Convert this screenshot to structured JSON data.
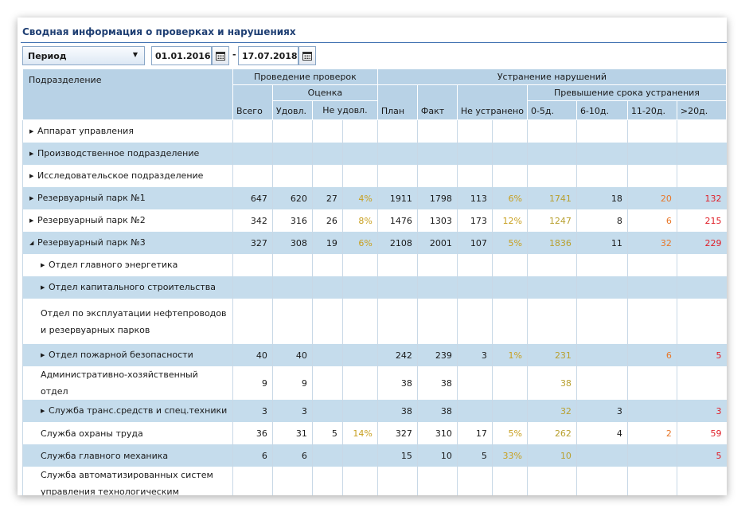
{
  "title": "Сводная информация о проверках и нарушениях",
  "toolbar": {
    "period_label": "Период",
    "date_from": "01.01.2016",
    "date_sep": "-",
    "date_to": "17.07.2018"
  },
  "headers": {
    "division": "Подразделение",
    "inspections": "Проведение проверок",
    "rating": "Оценка",
    "total": "Всего",
    "satisfactory": "Удовл.",
    "unsatisfactory": "Не удовл.",
    "elimination": "Устранение нарушений",
    "plan": "План",
    "fact": "Факт",
    "not_eliminated": "Не устранено",
    "overdue": "Превышение срока устранения",
    "d0_5": "0-5д.",
    "d6_10": "6-10д.",
    "d11_20": "11-20д.",
    "d20": ">20д."
  },
  "colors": {
    "header_bg": "#b8d2e6",
    "row_alt_bg": "#c5dcec",
    "title_color": "#1f3f73",
    "pct_color": "#c8a020",
    "orange": "#e8782a",
    "red": "#e0202a"
  },
  "rows": [
    {
      "name": "Аппарат управления",
      "expand": "collapsed",
      "level": 0,
      "alt": false,
      "tall": false,
      "total": "",
      "sat": "",
      "unsat": "",
      "unsat_pct": "",
      "plan": "",
      "fact": "",
      "not_elim": "",
      "not_elim_pct": "",
      "d0_5": "",
      "d6_10": "",
      "d11_20": "",
      "d20": ""
    },
    {
      "name": "Производственное подразделение",
      "expand": "collapsed",
      "level": 0,
      "alt": true,
      "tall": false,
      "total": "",
      "sat": "",
      "unsat": "",
      "unsat_pct": "",
      "plan": "",
      "fact": "",
      "not_elim": "",
      "not_elim_pct": "",
      "d0_5": "",
      "d6_10": "",
      "d11_20": "",
      "d20": ""
    },
    {
      "name": "Исследовательское подразделение",
      "expand": "collapsed",
      "level": 0,
      "alt": false,
      "tall": false,
      "total": "",
      "sat": "",
      "unsat": "",
      "unsat_pct": "",
      "plan": "",
      "fact": "",
      "not_elim": "",
      "not_elim_pct": "",
      "d0_5": "",
      "d6_10": "",
      "d11_20": "",
      "d20": ""
    },
    {
      "name": "Резервуарный парк №1",
      "expand": "collapsed",
      "level": 0,
      "alt": true,
      "tall": false,
      "total": "647",
      "sat": "620",
      "unsat": "27",
      "unsat_pct": "4%",
      "plan": "1911",
      "fact": "1798",
      "not_elim": "113",
      "not_elim_pct": "6%",
      "d0_5": "1741",
      "d6_10": "18",
      "d11_20": "20",
      "d20": "132"
    },
    {
      "name": "Резервуарный парк №2",
      "expand": "collapsed",
      "level": 0,
      "alt": false,
      "tall": false,
      "total": "342",
      "sat": "316",
      "unsat": "26",
      "unsat_pct": "8%",
      "plan": "1476",
      "fact": "1303",
      "not_elim": "173",
      "not_elim_pct": "12%",
      "d0_5": "1247",
      "d6_10": "8",
      "d11_20": "6",
      "d20": "215"
    },
    {
      "name": "Резервуарный парк №3",
      "expand": "expanded",
      "level": 0,
      "alt": true,
      "tall": false,
      "total": "327",
      "sat": "308",
      "unsat": "19",
      "unsat_pct": "6%",
      "plan": "2108",
      "fact": "2001",
      "not_elim": "107",
      "not_elim_pct": "5%",
      "d0_5": "1836",
      "d6_10": "11",
      "d11_20": "32",
      "d20": "229"
    },
    {
      "name": "Отдел главного энергетика",
      "expand": "collapsed",
      "level": 1,
      "alt": false,
      "tall": false,
      "total": "",
      "sat": "",
      "unsat": "",
      "unsat_pct": "",
      "plan": "",
      "fact": "",
      "not_elim": "",
      "not_elim_pct": "",
      "d0_5": "",
      "d6_10": "",
      "d11_20": "",
      "d20": ""
    },
    {
      "name": "Отдел капитального строительства",
      "expand": "collapsed",
      "level": 1,
      "alt": true,
      "tall": false,
      "total": "",
      "sat": "",
      "unsat": "",
      "unsat_pct": "",
      "plan": "",
      "fact": "",
      "not_elim": "",
      "not_elim_pct": "",
      "d0_5": "",
      "d6_10": "",
      "d11_20": "",
      "d20": ""
    },
    {
      "name": "Отдел по эксплуатации нефтепроводов и резервуарных парков",
      "expand": "none",
      "level": 1,
      "alt": false,
      "tall": true,
      "total": "",
      "sat": "",
      "unsat": "",
      "unsat_pct": "",
      "plan": "",
      "fact": "",
      "not_elim": "",
      "not_elim_pct": "",
      "d0_5": "",
      "d6_10": "",
      "d11_20": "",
      "d20": ""
    },
    {
      "name": "Отдел пожарной безопасности",
      "expand": "collapsed",
      "level": 1,
      "alt": true,
      "tall": false,
      "total": "40",
      "sat": "40",
      "unsat": "",
      "unsat_pct": "",
      "plan": "242",
      "fact": "239",
      "not_elim": "3",
      "not_elim_pct": "1%",
      "d0_5": "231",
      "d6_10": "",
      "d11_20": "6",
      "d20": "5"
    },
    {
      "name": "Административно-хозяйственный отдел",
      "expand": "none",
      "level": 1,
      "alt": false,
      "tall": false,
      "total": "9",
      "sat": "9",
      "unsat": "",
      "unsat_pct": "",
      "plan": "38",
      "fact": "38",
      "not_elim": "",
      "not_elim_pct": "",
      "d0_5": "38",
      "d6_10": "",
      "d11_20": "",
      "d20": ""
    },
    {
      "name": "Служба транс.средств и спец.техники",
      "expand": "collapsed",
      "level": 1,
      "alt": true,
      "tall": false,
      "total": "3",
      "sat": "3",
      "unsat": "",
      "unsat_pct": "",
      "plan": "38",
      "fact": "38",
      "not_elim": "",
      "not_elim_pct": "",
      "d0_5": "32",
      "d6_10": "3",
      "d11_20": "",
      "d20": "3"
    },
    {
      "name": "Служба охраны труда",
      "expand": "none",
      "level": 1,
      "alt": false,
      "tall": false,
      "total": "36",
      "sat": "31",
      "unsat": "5",
      "unsat_pct": "14%",
      "plan": "327",
      "fact": "310",
      "not_elim": "17",
      "not_elim_pct": "5%",
      "d0_5": "262",
      "d6_10": "4",
      "d11_20": "2",
      "d20": "59"
    },
    {
      "name": "Служба главного механика",
      "expand": "none",
      "level": 1,
      "alt": true,
      "tall": false,
      "total": "6",
      "sat": "6",
      "unsat": "",
      "unsat_pct": "",
      "plan": "15",
      "fact": "10",
      "not_elim": "5",
      "not_elim_pct": "33%",
      "d0_5": "10",
      "d6_10": "",
      "d11_20": "",
      "d20": "5"
    },
    {
      "name": "Служба автоматизированных систем управления технологическим процессом",
      "expand": "none",
      "level": 1,
      "alt": false,
      "tall": true,
      "total": "",
      "sat": "",
      "unsat": "",
      "unsat_pct": "",
      "plan": "",
      "fact": "",
      "not_elim": "",
      "not_elim_pct": "",
      "d0_5": "",
      "d6_10": "",
      "d11_20": "",
      "d20": ""
    }
  ]
}
